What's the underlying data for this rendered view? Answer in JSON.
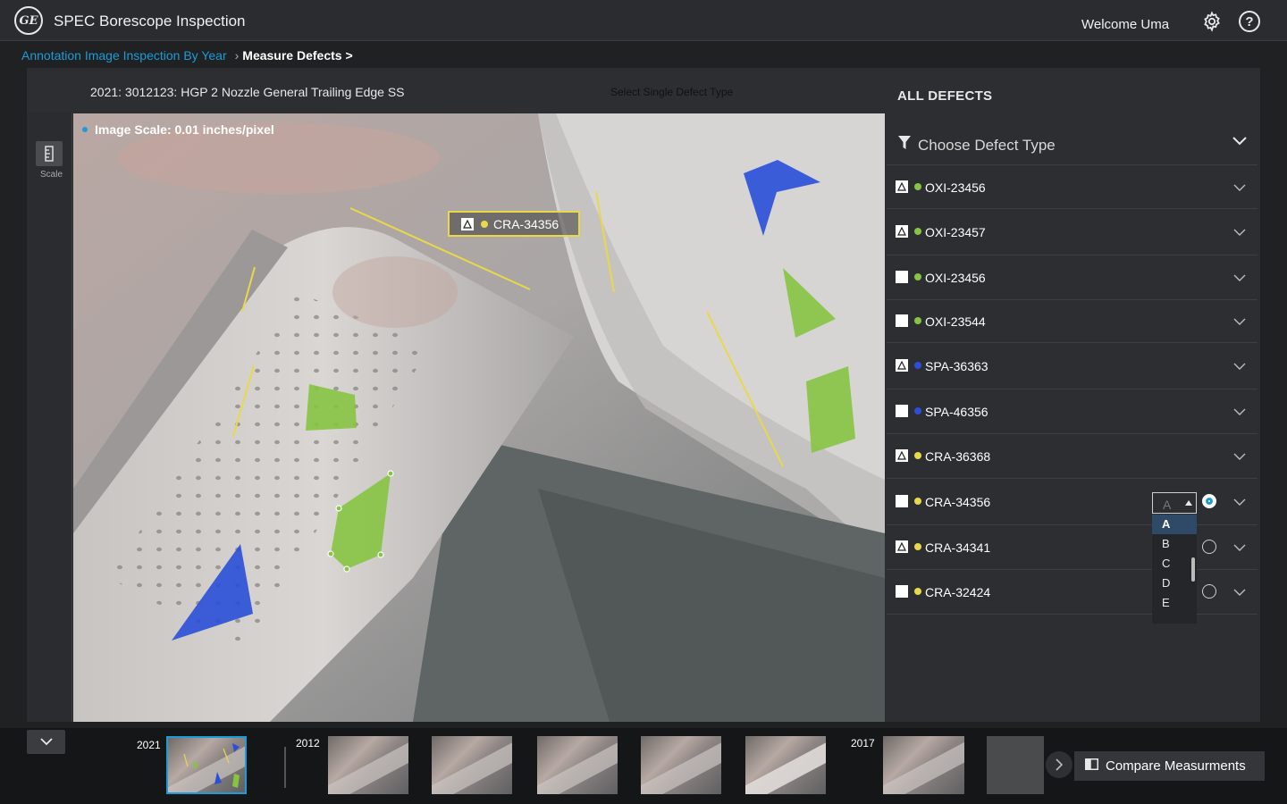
{
  "header": {
    "logo_text": "GE",
    "app_title": "SPEC Borescope Inspection",
    "welcome": "Welcome Uma",
    "settings_icon": "gear-icon",
    "help_icon": "help-icon",
    "help_glyph": "?"
  },
  "breadcrumb": {
    "link": "Annotation Image Inspection By Year",
    "separator": "›",
    "current": "Measure Defects >"
  },
  "workspace": {
    "asset_title": "2021: 3012123:  HGP 2 Nozzle General Trailing Edge SS",
    "hint": "Select Single Defect Type",
    "scale_tool_label": "Scale",
    "image_scale": "Image Scale: 0.01 inches/pixel",
    "selected_tag": "CRA-34356"
  },
  "colors": {
    "accent": "#1e9bd7",
    "status_green": "#86c442",
    "status_blue": "#2a4fd8",
    "status_yellow": "#e8d84a"
  },
  "panel": {
    "title": "ALL DEFECTS",
    "filter_label": "Choose Defect Type",
    "defects": [
      {
        "id": "OXI-23456",
        "box": "annot",
        "color": "#86c442"
      },
      {
        "id": "OXI-23457",
        "box": "annot",
        "color": "#86c442"
      },
      {
        "id": "OXI-23456",
        "box": "checked",
        "color": "#86c442"
      },
      {
        "id": "OXI-23544",
        "box": "checked",
        "color": "#86c442"
      },
      {
        "id": "SPA-36363",
        "box": "annot",
        "color": "#2a4fd8"
      },
      {
        "id": "SPA-46356",
        "box": "checked",
        "color": "#2a4fd8"
      },
      {
        "id": "CRA-36368",
        "box": "annot",
        "color": "#e8d84a"
      },
      {
        "id": "CRA-34356",
        "box": "checked",
        "color": "#e8d84a"
      },
      {
        "id": "CRA-34341",
        "box": "annot",
        "color": "#e8d84a"
      },
      {
        "id": "CRA-32424",
        "box": "checked",
        "color": "#e8d84a"
      }
    ],
    "dropdown": {
      "selected": "A",
      "options": [
        "A",
        "B",
        "C",
        "D",
        "E"
      ]
    }
  },
  "footer": {
    "years": [
      "2021",
      "2012",
      "2017"
    ],
    "compare_label": "Compare Measurments"
  }
}
